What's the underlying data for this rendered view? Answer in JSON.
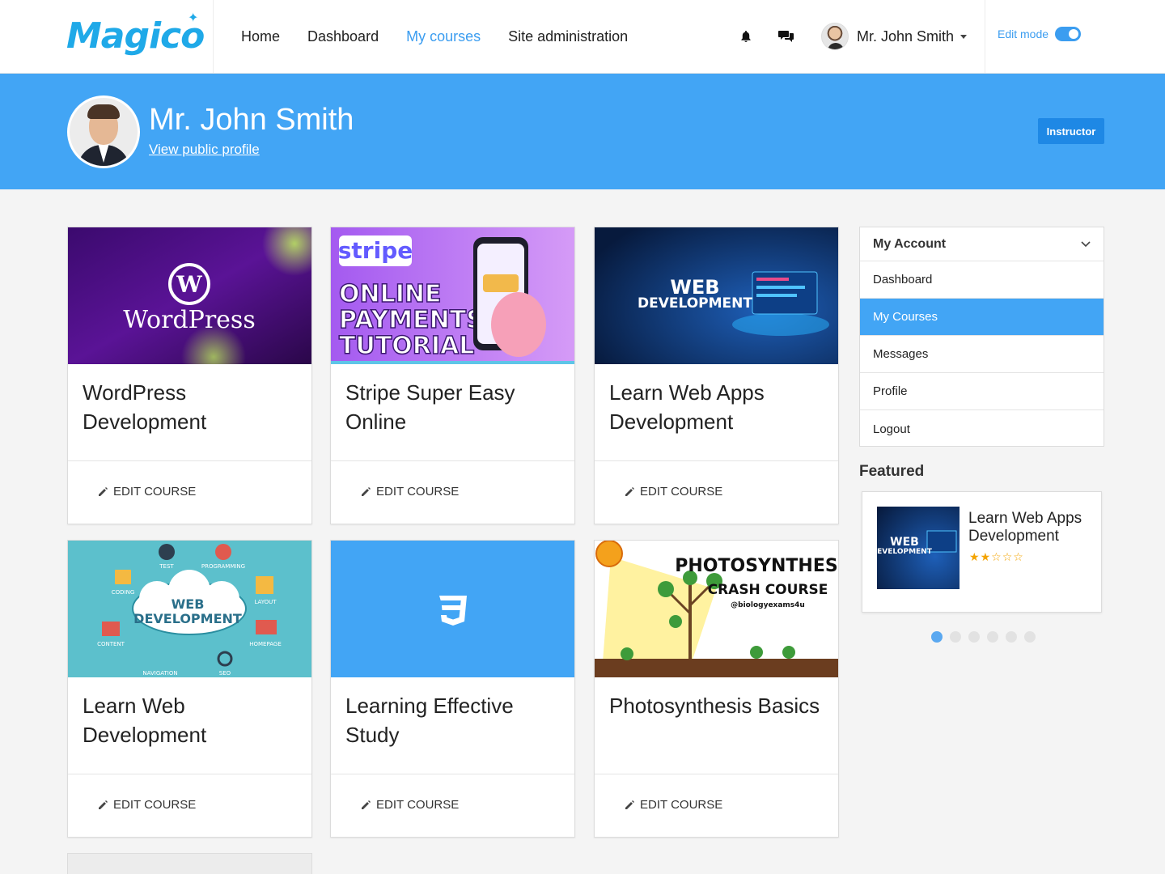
{
  "brand": {
    "name": "Magico"
  },
  "nav": {
    "links": [
      {
        "label": "Home"
      },
      {
        "label": "Dashboard"
      },
      {
        "label": "My courses",
        "active": true
      },
      {
        "label": "Site administration"
      }
    ],
    "icons": [
      "bell-icon",
      "chat-icon"
    ],
    "user_name": "Mr. John Smith",
    "edit_mode_label": "Edit mode",
    "edit_mode_on": true
  },
  "profile": {
    "name": "Mr. John Smith",
    "public_profile_link": "View public profile",
    "role": "Instructor"
  },
  "courses": [
    {
      "title": "WordPress Development",
      "action": "EDIT COURSE",
      "image_text": "WordPress"
    },
    {
      "title": "Stripe Super Easy Online",
      "action": "EDIT COURSE",
      "image_text": "ONLINE PAYMENTS TUTORIAL",
      "image_brand": "stripe"
    },
    {
      "title": "Learn Web Apps Development",
      "action": "EDIT COURSE",
      "image_text": "WEB DEVELOPMENT"
    },
    {
      "title": "Learn Web Development",
      "action": "EDIT COURSE",
      "image_text": "WEB DEVELOPMENT"
    },
    {
      "title": "Learning Effective Study",
      "action": "EDIT COURSE",
      "image_text": ""
    },
    {
      "title": "Photosynthesis Basics",
      "action": "EDIT COURSE",
      "image_text": "PHOTOSYNTHESIS",
      "image_subtext": "CRASH COURSE",
      "image_handle": "@biologyexams4u"
    }
  ],
  "web_dev_diagram_labels": [
    "TEST",
    "PROGRAMMING",
    "CODING",
    "LAYOUT",
    "CONTENT",
    "HOMEPAGE",
    "NAVIGATION",
    "SEO"
  ],
  "account_menu": {
    "title": "My Account",
    "items": [
      {
        "label": "Dashboard"
      },
      {
        "label": "My Courses",
        "active": true
      },
      {
        "label": "Messages"
      },
      {
        "label": "Profile"
      },
      {
        "label": "Logout"
      }
    ]
  },
  "featured": {
    "title": "Featured",
    "course_title": "Learn Web Apps Development",
    "thumb_text": "WEB DEVELOPMENT",
    "rating": 2,
    "rating_max": 5,
    "slides": 6,
    "active_slide": 1
  },
  "colors": {
    "brand": "#1fa9e8",
    "accent": "#42a5f5",
    "badge": "#1e88e5",
    "star": "#f4a400"
  }
}
